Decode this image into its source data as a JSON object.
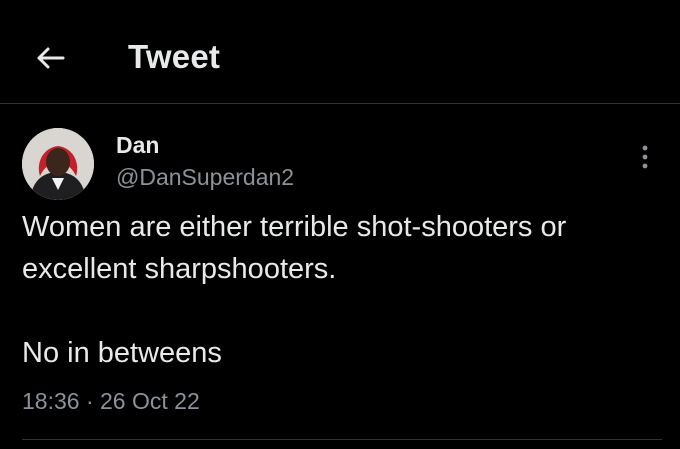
{
  "header": {
    "title": "Tweet",
    "back_icon": "arrow-left-icon"
  },
  "tweet": {
    "author": {
      "display_name": "Dan",
      "handle": "@DanSuperdan2",
      "avatar_icon": "user-avatar"
    },
    "more_icon": "more-vertical-icon",
    "text_lines": [
      "Women are either terrible shot-shooters or",
      "excellent sharpshooters."
    ],
    "text_last": "No in betweens",
    "time": "18:36",
    "separator": "·",
    "date": "26 Oct 22"
  },
  "colors": {
    "background": "#000000",
    "primary_text": "#e7e9ea",
    "secondary_text": "#8b9299",
    "divider": "#2f3336"
  }
}
